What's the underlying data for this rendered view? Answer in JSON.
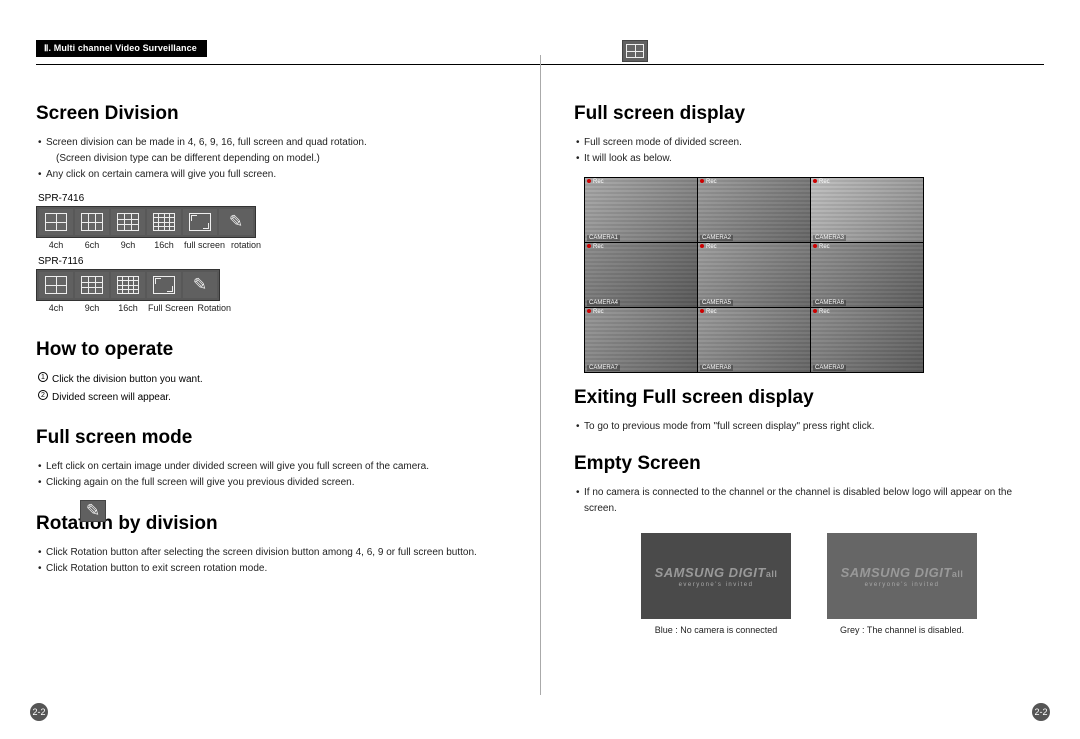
{
  "header": {
    "tab": "Ⅱ. Multi channel Video Surveillance"
  },
  "left": {
    "h_screen_division": "Screen Division",
    "sd_bullets": [
      "Screen division can be made in 4, 6, 9, 16, full screen and quad rotation.",
      "Any click on certain camera will give you full screen."
    ],
    "sd_sub": "(Screen division type can be different depending on model.)",
    "model1": "SPR-7416",
    "row1_labels": [
      "4ch",
      "6ch",
      "9ch",
      "16ch",
      "full screen",
      "rotation"
    ],
    "model2": "SPR-7116",
    "row2_labels": [
      "4ch",
      "9ch",
      "16ch",
      "Full Screen",
      "Rotation"
    ],
    "h_how": "How to operate",
    "how_items": [
      "Click the division button you want.",
      "Divided screen will appear."
    ],
    "h_full_mode": "Full screen mode",
    "fm_bullets": [
      "Left click on certain image under divided screen will give you full screen of the camera.",
      "Clicking again on the full screen will give you previous divided screen."
    ],
    "h_rotation": "Rotation by division",
    "rot_bullets": [
      "Click Rotation button after selecting the screen division button among 4, 6, 9 or full screen button.",
      "Click Rotation button to exit screen rotation mode."
    ]
  },
  "right": {
    "h_full_display": "Full screen display",
    "fd_bullets": [
      "Full screen mode of divided screen.",
      "It will look as below."
    ],
    "cam_labels": [
      "CAMERA1",
      "CAMERA2",
      "CAMERA3",
      "CAMERA4",
      "CAMERA5",
      "CAMERA6",
      "CAMERA7",
      "CAMERA8",
      "CAMERA9"
    ],
    "rec": "Rec",
    "h_exit": "Exiting Full screen display",
    "exit_bullets": [
      "To go to previous mode from \"full screen display\" press right click."
    ],
    "h_empty": "Empty Screen",
    "empty_bullets": [
      "If no camera is connected to the channel or the channel is disabled below logo will appear on the screen."
    ],
    "logo_brand": "SAMSUNG DIGIT",
    "logo_brand_small": "all",
    "logo_tag": "everyone's invited",
    "cap_blue": "Blue : No camera is connected",
    "cap_grey": "Grey : The channel is disabled."
  },
  "page_num": "2-2"
}
